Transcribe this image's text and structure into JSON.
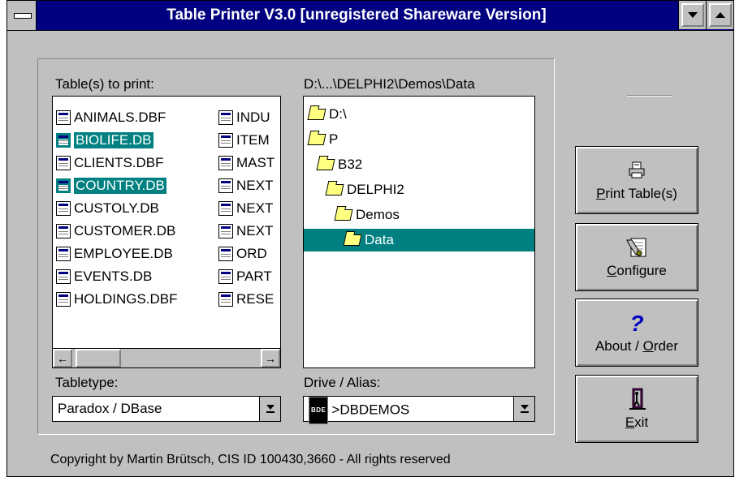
{
  "window": {
    "title": "Table Printer V3.0 [unregistered Shareware Version]"
  },
  "tables": {
    "label": "Table(s) to print:",
    "col1": [
      {
        "name": "ANIMALS.DBF",
        "selected": false
      },
      {
        "name": "BIOLIFE.DB",
        "selected": true
      },
      {
        "name": "CLIENTS.DBF",
        "selected": false
      },
      {
        "name": "COUNTRY.DB",
        "selected": true
      },
      {
        "name": "CUSTOLY.DB",
        "selected": false
      },
      {
        "name": "CUSTOMER.DB",
        "selected": false
      },
      {
        "name": "EMPLOYEE.DB",
        "selected": false
      },
      {
        "name": "EVENTS.DB",
        "selected": false
      },
      {
        "name": "HOLDINGS.DBF",
        "selected": false
      }
    ],
    "col2": [
      {
        "name": "INDU"
      },
      {
        "name": "ITEM"
      },
      {
        "name": "MAST"
      },
      {
        "name": "NEXT"
      },
      {
        "name": "NEXT"
      },
      {
        "name": "NEXT"
      },
      {
        "name": "ORD"
      },
      {
        "name": "PART"
      },
      {
        "name": "RESE"
      }
    ],
    "scroll_left": "←",
    "scroll_right": "→"
  },
  "directory": {
    "path_label": "D:\\...\\DELPHI2\\Demos\\Data",
    "items": [
      {
        "name": "D:\\",
        "level": 0,
        "selected": false,
        "open": true
      },
      {
        "name": "P",
        "level": 0,
        "selected": false,
        "open": true
      },
      {
        "name": "B32",
        "level": 1,
        "selected": false,
        "open": true
      },
      {
        "name": "DELPHI2",
        "level": 2,
        "selected": false,
        "open": true
      },
      {
        "name": "Demos",
        "level": 3,
        "selected": false,
        "open": true
      },
      {
        "name": "Data",
        "level": 4,
        "selected": true,
        "open": true
      }
    ]
  },
  "tabletype": {
    "label": "Tabletype:",
    "value": "Paradox / DBase"
  },
  "drive": {
    "label": "Drive / Alias:",
    "icon_text": "BDE",
    "value": ">DBDEMOS"
  },
  "buttons": {
    "print": {
      "mnemonic": "P",
      "rest": "rint Table(s)",
      "icon": "printer-icon"
    },
    "configure": {
      "mnemonic": "C",
      "rest": "onfigure",
      "icon": "wrench-icon"
    },
    "about": {
      "pre": "About / ",
      "mnemonic": "O",
      "rest": "rder",
      "icon": "question-icon"
    },
    "exit": {
      "mnemonic": "E",
      "rest": "xit",
      "icon": "exit-door-icon"
    }
  },
  "footer": {
    "copyright": "Copyright by Martin Brütsch, CIS ID 100430,3660 - All rights reserved"
  },
  "colors": {
    "titlebar": "#000080",
    "selection": "#008080",
    "face": "#c0c0c0"
  }
}
